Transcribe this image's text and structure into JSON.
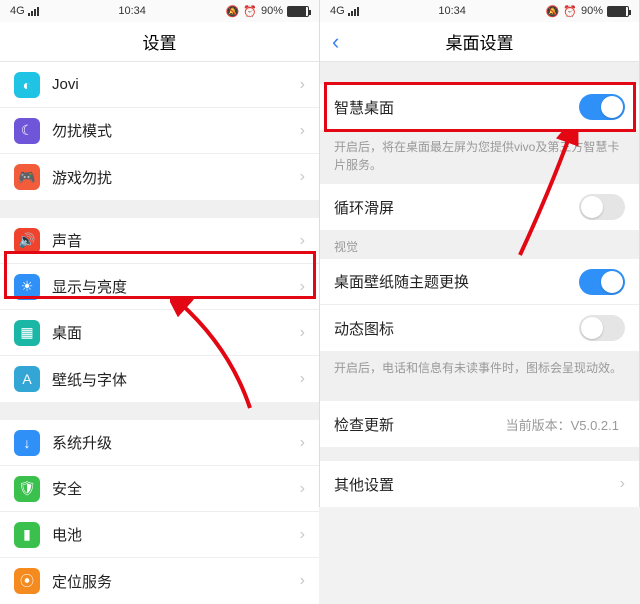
{
  "status": {
    "network": "4G",
    "time": "10:34",
    "battery_pct": "90%"
  },
  "left": {
    "title": "设置",
    "rows": {
      "jovi": "Jovi",
      "dnd": "勿扰模式",
      "game_dnd": "游戏勿扰",
      "sound": "声音",
      "display": "显示与亮度",
      "desktop": "桌面",
      "wallpaper": "壁纸与字体",
      "update": "系统升级",
      "security": "安全",
      "battery": "电池",
      "location": "定位服务"
    }
  },
  "right": {
    "title": "桌面设置",
    "smart_desktop": "智慧桌面",
    "smart_desktop_desc": "开启后，将在桌面最左屏为您提供vivo及第三方智慧卡片服务。",
    "loop_scroll": "循环滑屏",
    "vision_header": "视觉",
    "wallpaper_theme": "桌面壁纸随主题更换",
    "dynamic_icon": "动态图标",
    "dynamic_icon_desc": "开启后，电话和信息有未读事件时，图标会呈现动效。",
    "check_update": "检查更新",
    "version_label": "当前版本：V5.0.2.1",
    "other": "其他设置"
  }
}
